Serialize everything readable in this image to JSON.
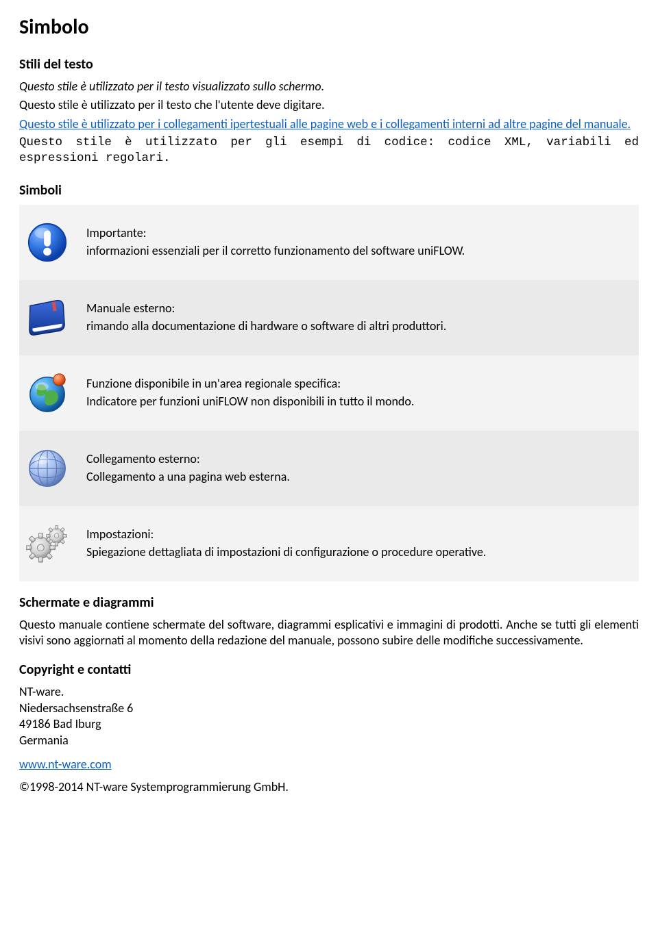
{
  "title": "Simbolo",
  "styles": {
    "heading": "Stili del testo",
    "screen": "Questo stile è utilizzato per il testo visualizzato sullo schermo.",
    "input": "Questo stile è utilizzato per il testo che l'utente deve digitare.",
    "links": "Questo stile è utilizzato per i collegamenti ipertestuali alle pagine web e i collegamenti interni ad altre pagine del manuale.",
    "code": "Questo stile è utilizzato per gli esempi di codice: codice XML, variabili ed espressioni regolari."
  },
  "symbols": {
    "heading": "Simboli",
    "rows": [
      {
        "label": "Importante:",
        "desc": "informazioni essenziali per il corretto funzionamento del software uniFLOW."
      },
      {
        "label": "Manuale esterno:",
        "desc": "rimando alla documentazione di hardware o software di altri produttori."
      },
      {
        "label": "Funzione disponibile in un'area regionale specifica:",
        "desc": "Indicatore per funzioni uniFLOW non disponibili in tutto il mondo."
      },
      {
        "label": "Collegamento esterno:",
        "desc": "Collegamento a una pagina web esterna."
      },
      {
        "label": "Impostazioni:",
        "desc": "Spiegazione dettagliata di impostazioni di configurazione o procedure operative."
      }
    ]
  },
  "screens": {
    "heading": "Schermate e diagrammi",
    "body": "Questo manuale contiene schermate del software, diagrammi esplicativi e immagini di prodotti. Anche se tutti gli elementi visivi sono aggiornati al momento della redazione del manuale, possono subire delle modifiche successivamente."
  },
  "contact": {
    "heading": "Copyright e contatti",
    "company": "NT-ware.",
    "street": "Niedersachsenstraße 6",
    "zipcity": "49186 Bad Iburg",
    "country": "Germania",
    "url": "www.nt-ware.com",
    "copyright": "©1998-2014 NT-ware Systemprogrammierung GmbH."
  }
}
